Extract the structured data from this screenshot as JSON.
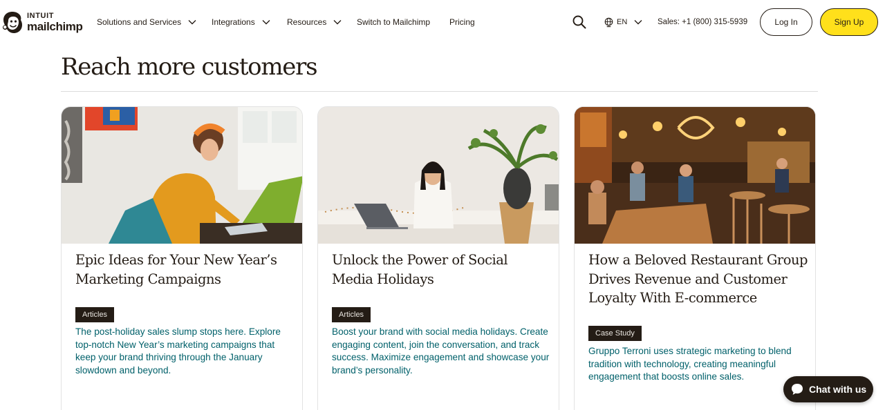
{
  "brand": {
    "line1": "INTUIT",
    "line2": "mailchimp"
  },
  "nav": {
    "items": [
      {
        "label": "Solutions and Services",
        "dropdown": true
      },
      {
        "label": "Integrations",
        "dropdown": true
      },
      {
        "label": "Resources",
        "dropdown": true
      },
      {
        "label": "Switch to Mailchimp",
        "dropdown": false
      },
      {
        "label": "Pricing",
        "dropdown": false
      }
    ],
    "language": "EN",
    "sales": "Sales: +1 (800) 315-5939",
    "login": "Log In",
    "signup": "Sign Up"
  },
  "section": {
    "title": "Reach more customers"
  },
  "cards": [
    {
      "title": "Epic Ideas for Your New Year’s Marketing Campaigns",
      "badge": "Articles",
      "description": "The post-holiday sales slump stops here. Explore top-notch New Year’s marketing campaigns that keep your brand thriving through the January slowdown and beyond."
    },
    {
      "title": "Unlock the Power of Social Media Holidays",
      "badge": "Articles",
      "description": "Boost your brand with social media holidays. Create engaging content, join the conversation, and track success. Maximize engagement and showcase your brand’s personality."
    },
    {
      "title": "How a Beloved Restaurant Group Drives Revenue and Customer Loyalty With E-commerce",
      "badge": "Case Study",
      "description": "Gruppo Terroni uses strategic marketing to blend tradition with technology, creating meaningful engagement that boosts online sales."
    }
  ],
  "chat": {
    "label": "Chat with us"
  },
  "colors": {
    "ink": "#241c15",
    "accent_yellow": "#ffe01b",
    "link_teal": "#00606a",
    "rule": "#dcdcdc"
  },
  "icons": {
    "logo": "freddie-chimp-icon",
    "search": "search-icon",
    "language": "globe-icon",
    "dropdown": "chevron-down-icon",
    "chat": "chat-bubble-icon"
  }
}
